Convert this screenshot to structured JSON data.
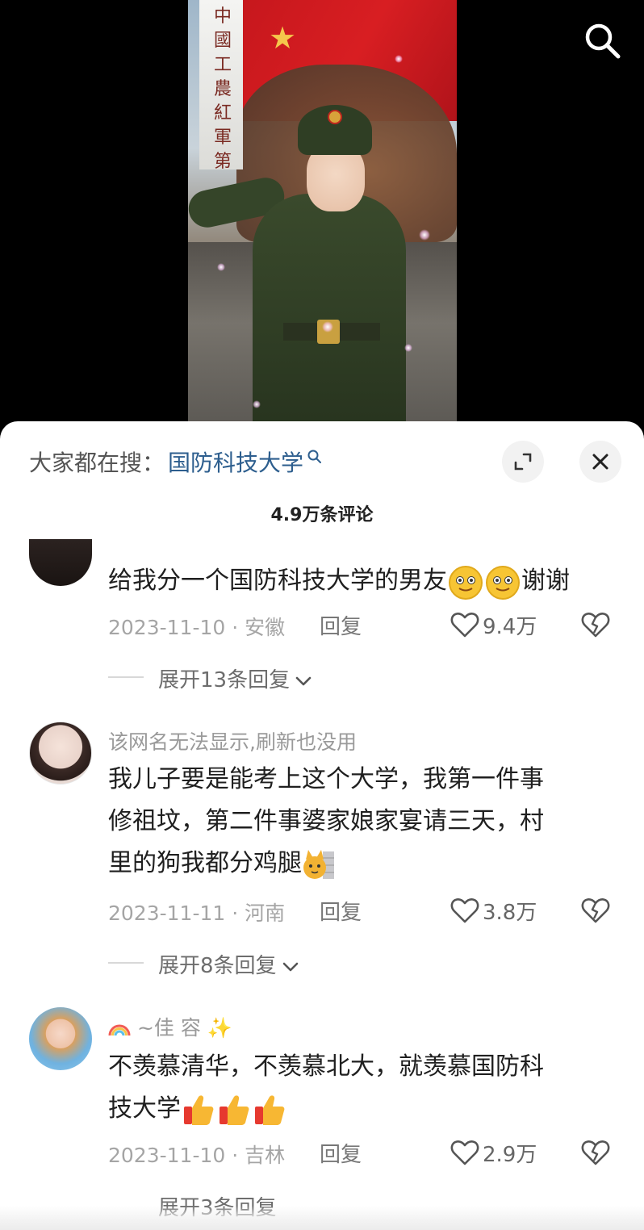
{
  "video": {
    "sign_text": "中國工農紅軍第"
  },
  "header": {
    "trend_prefix": "大家都在搜：",
    "trend_link": "国防科技大学",
    "comment_count": "4.9万条评论"
  },
  "comments": [
    {
      "username": "",
      "text": "给我分一个国防科技大学的男友",
      "text_after": "谢谢",
      "date_location": "2023-11-10 · 安徽",
      "reply_label": "回复",
      "likes": "9.4万",
      "expand_label": "展开13条回复"
    },
    {
      "username": "该网名无法显示,刷新也没用",
      "text_line1": "我儿子要是能考上这个大学，我第一件事",
      "text_line2": "修祖坟，第二件事婆家娘家宴请三天，村",
      "text_line3": "里的狗我都分鸡腿",
      "date_location": "2023-11-11 · 河南",
      "reply_label": "回复",
      "likes": "3.8万",
      "expand_label": "展开8条回复"
    },
    {
      "username": "~佳 容",
      "text_line1": "不羡慕清华，不羡慕北大，就羡慕国防科",
      "text_line2": "技大学",
      "date_location": "2023-11-10 · 吉林",
      "reply_label": "回复",
      "likes": "2.9万",
      "expand_label": "展开3条回复"
    }
  ],
  "icons": {
    "search": "search-icon",
    "expand": "expand-icon",
    "close": "close-icon",
    "like": "heart-icon",
    "dislike": "broken-heart-icon"
  },
  "colors": {
    "link": "#2d5e8e",
    "meta": "#a5a5a5",
    "text": "#1f1f1f"
  }
}
